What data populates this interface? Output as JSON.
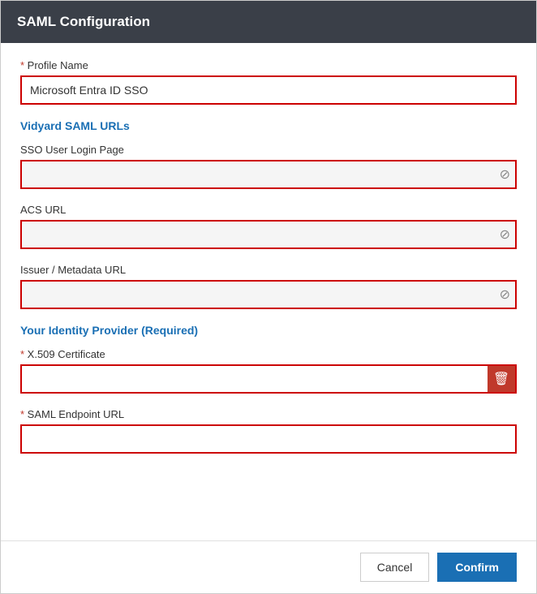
{
  "modal": {
    "title": "SAML Configuration",
    "scrollbar": {
      "visible": true
    }
  },
  "form": {
    "profile_name": {
      "label": "Profile Name",
      "required": true,
      "value": "Microsoft Entra ID SSO",
      "placeholder": ""
    },
    "vidyard_saml_urls": {
      "heading": "Vidyard SAML URLs",
      "sso_user_login_page": {
        "label": "SSO User Login Page",
        "required": false,
        "value": "",
        "placeholder": ""
      },
      "acs_url": {
        "label": "ACS URL",
        "required": false,
        "value": "",
        "placeholder": ""
      },
      "issuer_metadata_url": {
        "label": "Issuer / Metadata URL",
        "required": false,
        "value": "",
        "placeholder": ""
      }
    },
    "identity_provider": {
      "heading": "Your Identity Provider (Required)",
      "x509_certificate": {
        "label": "X.509 Certificate",
        "required": true,
        "value": "",
        "placeholder": ""
      },
      "saml_endpoint_url": {
        "label": "SAML Endpoint URL",
        "required": true,
        "value": "",
        "placeholder": ""
      }
    }
  },
  "footer": {
    "cancel_label": "Cancel",
    "confirm_label": "Confirm"
  },
  "icons": {
    "no_entry": "⊘",
    "trash": "🗑"
  }
}
